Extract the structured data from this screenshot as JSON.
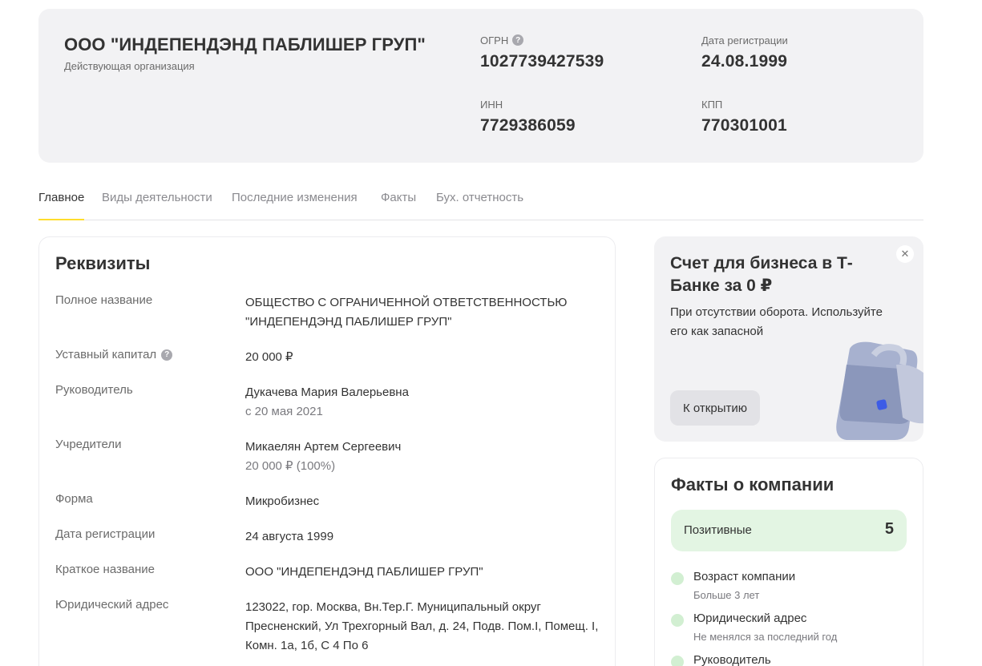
{
  "header": {
    "company_name": "ООО \"ИНДЕПЕНДЭНД ПАБЛИШЕР ГРУП\"",
    "status": "Действующая организация",
    "ogrn_label": "ОГРН",
    "ogrn_value": "1027739427539",
    "reg_date_label": "Дата регистрации",
    "reg_date_value": "24.08.1999",
    "inn_label": "ИНН",
    "inn_value": "7729386059",
    "kpp_label": "КПП",
    "kpp_value": "770301001",
    "help_icon": "question-icon"
  },
  "tabs": [
    {
      "label": "Главное",
      "active": true
    },
    {
      "label": "Виды деятельности",
      "active": false
    },
    {
      "label": "Последние изменения",
      "active": false
    },
    {
      "label": "Факты",
      "active": false
    },
    {
      "label": "Бух. отчетность",
      "active": false
    }
  ],
  "requisites": {
    "title": "Реквизиты",
    "rows": [
      {
        "label": "Полное название",
        "value": "ОБЩЕСТВО С ОГРАНИЧЕННОЙ ОТВЕТСТВЕННОСТЬЮ \"ИНДЕПЕНДЭНД ПАБЛИШЕР ГРУП\"",
        "sub": ""
      },
      {
        "label": "Уставный капитал",
        "value": "20 000 ₽",
        "sub": ""
      },
      {
        "label": "Руководитель",
        "value": "Дукачева Мария Валерьевна",
        "sub": "с 20 мая 2021"
      },
      {
        "label": "Учредители",
        "value": "Микаелян Артем Сергеевич",
        "sub": "20 000 ₽ (100%)"
      },
      {
        "label": "Форма",
        "value": "Микробизнес",
        "sub": ""
      },
      {
        "label": "Дата регистрации",
        "value": "24 августа 1999",
        "sub": ""
      },
      {
        "label": "Краткое название",
        "value": "ООО \"ИНДЕПЕНДЭНД ПАБЛИШЕР ГРУП\"",
        "sub": ""
      },
      {
        "label": "Юридический адрес",
        "value": "123022, гор. Москва, Вн.Тер.Г. Муниципальный округ Пресненский, Ул Трехгорный Вал, д. 24, Подв. Пом.I, Помещ. I, Комн. 1а, 1б, С 4 По 6",
        "sub": ""
      }
    ]
  },
  "promo": {
    "title": "Счет для бизнеса в Т-Банке за 0 ₽",
    "text": "При отсутствии оборота. Используйте его как запасной",
    "button": "К открытию",
    "close_icon": "close-icon"
  },
  "facts": {
    "title": "Факты о компании",
    "positive_label": "Позитивные",
    "positive_count": "5",
    "items": [
      {
        "title": "Возраст компании",
        "sub": "Больше 3 лет"
      },
      {
        "title": "Юридический адрес",
        "sub": "Не менялся за последний год"
      },
      {
        "title": "Руководитель",
        "sub": ""
      }
    ]
  },
  "colors": {
    "accent": "#ffdd2d",
    "header_bg": "#f2f2f4",
    "positive_bg": "#e3f5e3",
    "positive_dot": "#d2efd2"
  }
}
